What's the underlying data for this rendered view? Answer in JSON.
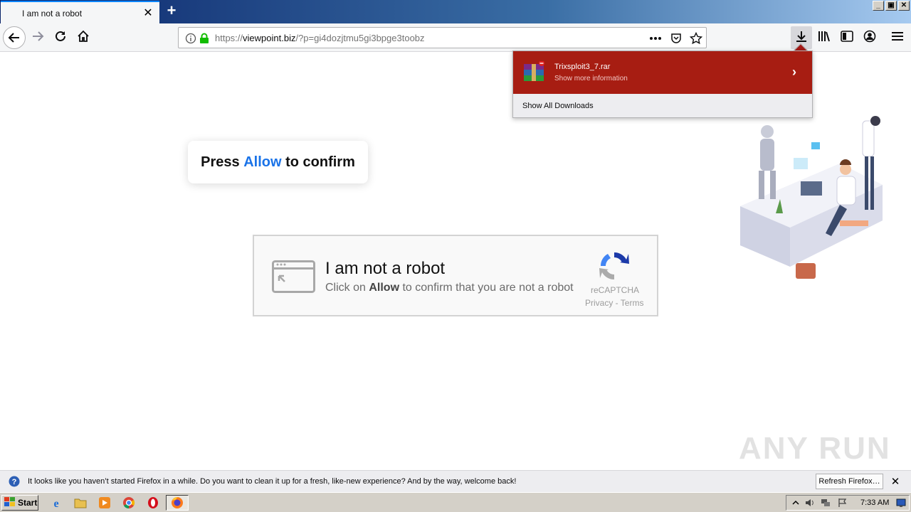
{
  "browser": {
    "tab_title": "I am not a robot",
    "tab_close": "✕",
    "new_tab": "+",
    "url_prefix": "https://",
    "url_host": "viewpoint.biz",
    "url_path": "/?p=gi4dozjtmu5gi3bpge3toobz",
    "window_buttons": [
      "_",
      "▣",
      "✕"
    ]
  },
  "downloads_panel": {
    "file_name": "Trixsploit3_7.rar",
    "subtitle": "Show more information",
    "show_all": "Show All Downloads",
    "accent_color": "#a71d12"
  },
  "page": {
    "press_before": "Press ",
    "press_allow": "Allow",
    "press_after": " to confirm",
    "captcha": {
      "title": "I am not a robot",
      "sub_before": "Click on ",
      "sub_allow": "Allow",
      "sub_after": " to confirm that you are not a robot",
      "brand": "reCAPTCHA",
      "links": "Privacy - Terms"
    },
    "watermark": "ANY RUN"
  },
  "notification": {
    "text": "It looks like you haven’t started Firefox in a while. Do you want to clean it up for a fresh, like-new experience? And by the way, welcome back!",
    "button": "Refresh Firefox…",
    "close": "✕"
  },
  "taskbar": {
    "start_label": "Start",
    "time": "7:33 AM",
    "apps": [
      "ie-icon",
      "explorer-icon",
      "media-player-icon",
      "chrome-icon",
      "opera-icon",
      "firefox-icon"
    ]
  }
}
